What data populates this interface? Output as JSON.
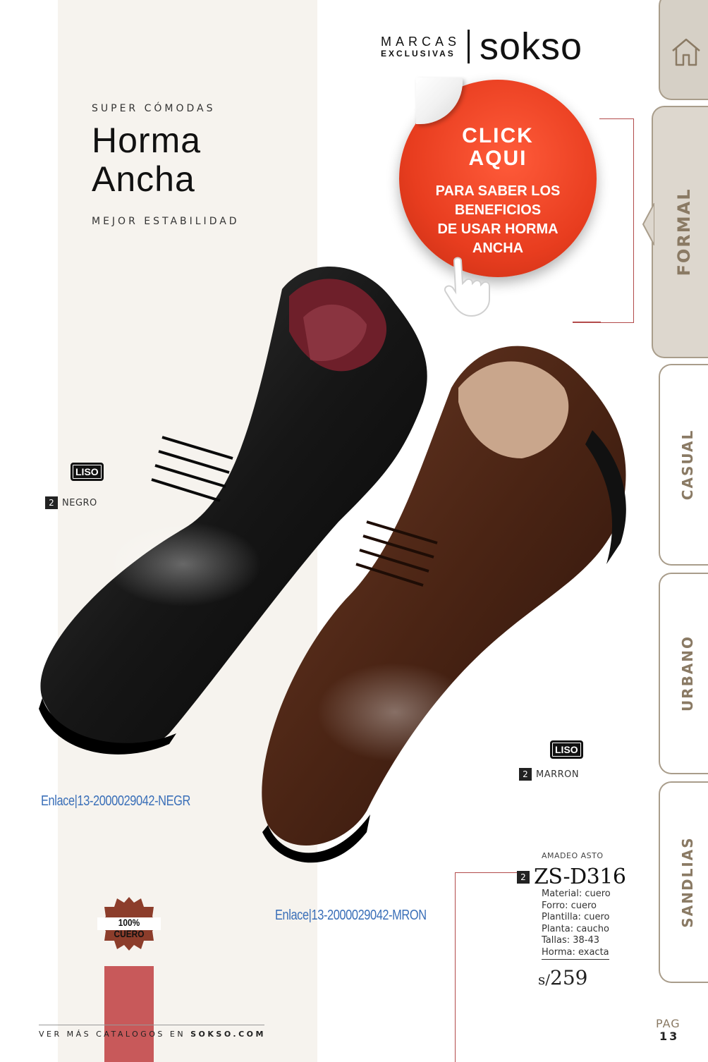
{
  "brand": {
    "marcas": "MARCAS",
    "exclusivas": "EXCLUSIVAS",
    "logo": "sokso"
  },
  "hero": {
    "kicker": "SUPER CÓMODAS",
    "title_line1": "Horma",
    "title_line2": "Ancha",
    "subtitle": "MEJOR ESTABILIDAD"
  },
  "cta": {
    "headline_line1": "CLICK",
    "headline_line2": "AQUI",
    "body": "PARA SABER LOS\nBENEFICIOS\nDE USAR HORMA\nANCHA"
  },
  "variants": [
    {
      "finish": "LISO",
      "count": "2",
      "color": "NEGRO",
      "link": "Enlace|13-2000029042-NEGR"
    },
    {
      "finish": "LISO",
      "count": "2",
      "color": "MARRON",
      "link": "Enlace|13-2000029042-MRON"
    }
  ],
  "badge": {
    "text": "100% CUERO"
  },
  "product": {
    "brand": "AMADEO ASTO",
    "count": "2",
    "code": "ZS-D316",
    "specs": [
      "Material: cuero",
      "Forro: cuero",
      "Plantilla: cuero",
      "Planta: caucho",
      "Tallas: 38-43",
      "Horma: exacta"
    ],
    "currency": "s/",
    "price": "259"
  },
  "footer": {
    "text": "VER MÁS CATALOGOS EN",
    "site": "SOKSO.COM"
  },
  "tabs": {
    "home_icon": "home-icon",
    "items": [
      "FORMAL",
      "CASUAL",
      "URBANO",
      "SANDLIAS"
    ],
    "active": "FORMAL"
  },
  "page": {
    "label": "PAG",
    "number": "13"
  },
  "colors": {
    "accent_red": "#c8595a",
    "cta_red": "#e83d1f",
    "tab_beige": "#d6d0c6",
    "link_blue": "#3a6fb8"
  }
}
